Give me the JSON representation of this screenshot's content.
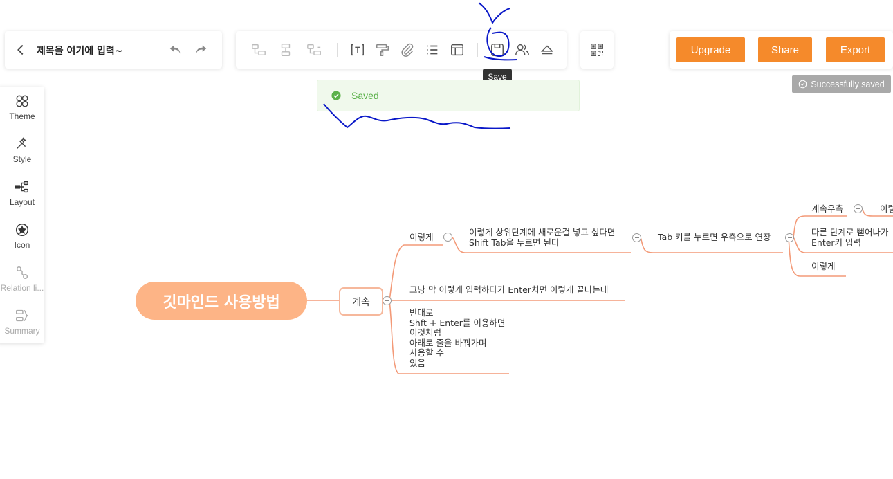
{
  "header": {
    "back_label": "<",
    "doc_title": "제목을 여기에 입력~"
  },
  "toolbar": {
    "tooltip": "Save"
  },
  "actions": {
    "upgrade": "Upgrade",
    "share": "Share",
    "export": "Export"
  },
  "toast": {
    "saved": "Saved",
    "success": "Successfully saved"
  },
  "sidebar": {
    "items": [
      {
        "label": "Theme",
        "icon": "theme-icon"
      },
      {
        "label": "Style",
        "icon": "style-icon"
      },
      {
        "label": "Layout",
        "icon": "layout-icon"
      },
      {
        "label": "Icon",
        "icon": "icon-icon"
      },
      {
        "label": "Relation li...",
        "icon": "relation-icon"
      },
      {
        "label": "Summary",
        "icon": "summary-icon"
      }
    ]
  },
  "mindmap": {
    "root": "깃마인드 사용방법",
    "child": "계속",
    "n_iltgeke": "이렇게",
    "n_upper_1": "이렇게 상위단계에 새로운걸 넣고 싶다면",
    "n_upper_2": "Shift Tab을 누르면 된다",
    "n_tab": "Tab 키를 누르면 우측으로 연장",
    "n_right1": "계속우측",
    "n_right1b": "이렇",
    "n_right2_1": "다른 단계로 뻗어나가",
    "n_right2_2": "Enter키 입력",
    "n_right3": "이렇게",
    "n_enter": "그냥 막 이렇게 입력하다가 Enter치면 이렇게 끝나는데",
    "n_multi": [
      "반대로",
      "Shft + Enter를 이용하면",
      "이것처럼",
      "아래로 줄을 바꿔가며",
      "사용할 수",
      "있음"
    ]
  },
  "colors": {
    "accent": "#f58a2b",
    "root_fill": "#fdb486",
    "branch_line": "#f39a78",
    "saved_green": "#5bb14a"
  }
}
